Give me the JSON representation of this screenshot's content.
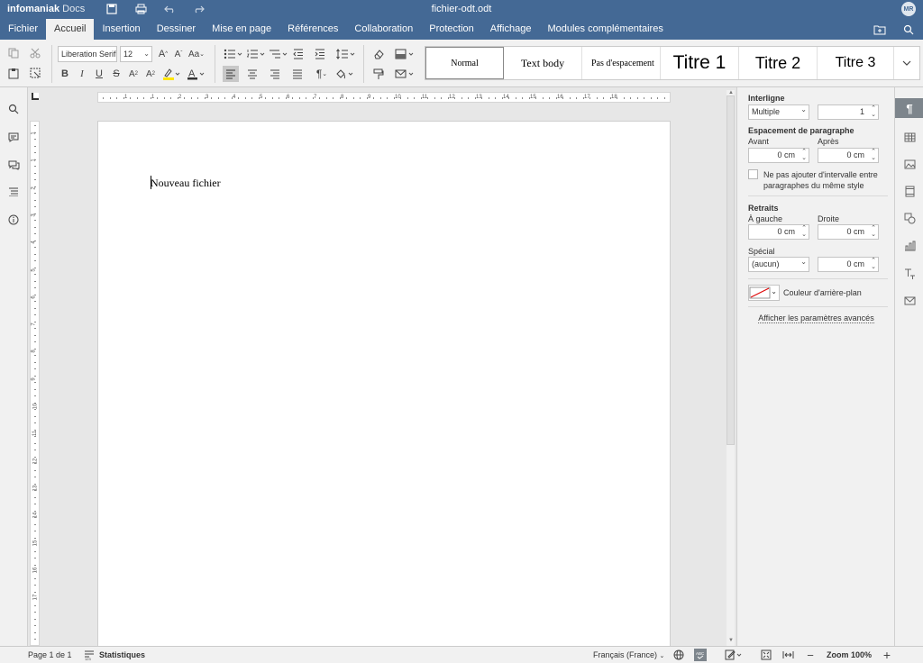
{
  "app": {
    "brand_bold": "infomaniak",
    "brand_light": "Docs",
    "doc_title": "fichier-odt.odt",
    "user_initials": "MR"
  },
  "tabs": [
    {
      "label": "Fichier"
    },
    {
      "label": "Accueil"
    },
    {
      "label": "Insertion"
    },
    {
      "label": "Dessiner"
    },
    {
      "label": "Mise en page"
    },
    {
      "label": "Références"
    },
    {
      "label": "Collaboration"
    },
    {
      "label": "Protection"
    },
    {
      "label": "Affichage"
    },
    {
      "label": "Modules complémentaires"
    }
  ],
  "toolbar": {
    "font_name": "Liberation Serif",
    "font_size": "12",
    "text_case_label": "Aa",
    "grow_label": "A",
    "shrink_label": "A"
  },
  "styles": [
    {
      "label": "Normal"
    },
    {
      "label": "Text body"
    },
    {
      "label": "Pas d'espacement"
    },
    {
      "label": "Titre 1"
    },
    {
      "label": "Titre 2"
    },
    {
      "label": "Titre 3"
    }
  ],
  "document": {
    "text": "Nouveau fichier"
  },
  "ruler": {
    "h_numbers": [
      "1",
      "1",
      "2",
      "3",
      "4",
      "5",
      "6",
      "7",
      "8",
      "9",
      "10",
      "11",
      "12",
      "13",
      "14",
      "15",
      "16",
      "17",
      "18"
    ],
    "v_numbers": [
      "1",
      "1",
      "2",
      "3",
      "4",
      "5",
      "6",
      "7",
      "8",
      "9",
      "10",
      "11",
      "12",
      "13",
      "14",
      "15",
      "16",
      "17"
    ]
  },
  "panel": {
    "interligne": {
      "title": "Interligne",
      "mode": "Multiple",
      "value": "1"
    },
    "espacement": {
      "title": "Espacement de paragraphe",
      "avant_label": "Avant",
      "apres_label": "Après",
      "avant_value": "0 cm",
      "apres_value": "0 cm",
      "checkbox_label": "Ne pas ajouter d'intervalle entre paragraphes du même style"
    },
    "retraits": {
      "title": "Retraits",
      "gauche_label": "À gauche",
      "droite_label": "Droite",
      "gauche_value": "0 cm",
      "droite_value": "0 cm",
      "special_label": "Spécial",
      "special_mode": "(aucun)",
      "special_value": "0 cm"
    },
    "background_label": "Couleur d'arrière-plan",
    "advanced_link": "Afficher les paramètres avancés"
  },
  "status": {
    "page": "Page 1 de 1",
    "stats": "Statistiques",
    "language": "Français (France)",
    "zoom": "Zoom 100%"
  },
  "colors": {
    "header": "#446995",
    "toolbar": "#f1f1f1",
    "highlight": "#ffe600",
    "font_color": "#333333"
  }
}
